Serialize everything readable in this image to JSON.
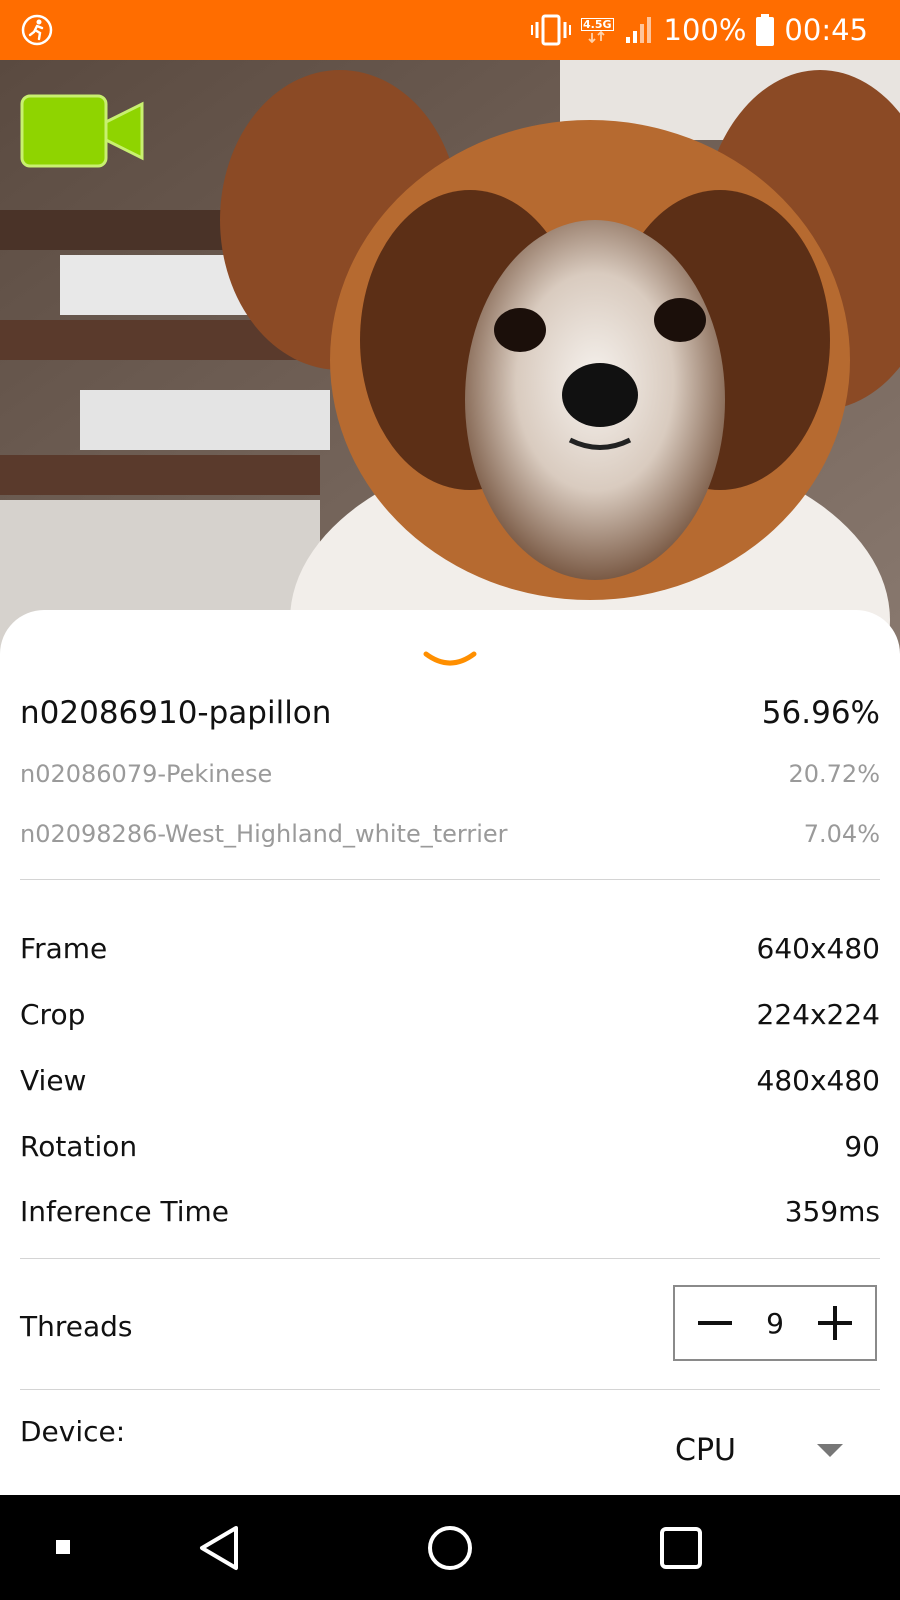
{
  "status_bar": {
    "left_icon": "fitness-activity-icon",
    "icons": [
      "vibrate-icon",
      "network-4.5g-icon",
      "signal-icon",
      "battery-icon"
    ],
    "network_label": "4.5G",
    "battery": "100%",
    "time": "00:45"
  },
  "camera": {
    "video_button_icon": "video-camera-icon",
    "subject": "papillon dog camera preview"
  },
  "results": [
    {
      "label": "n02086910-papillon",
      "score": "56.96%"
    },
    {
      "label": "n02086079-Pekinese",
      "score": "20.72%"
    },
    {
      "label": "n02098286-West_Highland_white_terrier",
      "score": "7.04%"
    }
  ],
  "info": [
    {
      "label": "Frame",
      "value": "640x480"
    },
    {
      "label": "Crop",
      "value": "224x224"
    },
    {
      "label": "View",
      "value": "480x480"
    },
    {
      "label": "Rotation",
      "value": "90"
    },
    {
      "label": "Inference Time",
      "value": "359ms"
    }
  ],
  "threads": {
    "label": "Threads",
    "value": "9"
  },
  "device": {
    "label": "Device:",
    "value": "CPU"
  },
  "colors": {
    "accent": "#ff6d00",
    "handle": "#ff8f00",
    "video_button": "#8fd400"
  },
  "nav": [
    "stop-square-icon",
    "back-triangle-icon",
    "home-circle-icon",
    "recents-square-icon"
  ]
}
